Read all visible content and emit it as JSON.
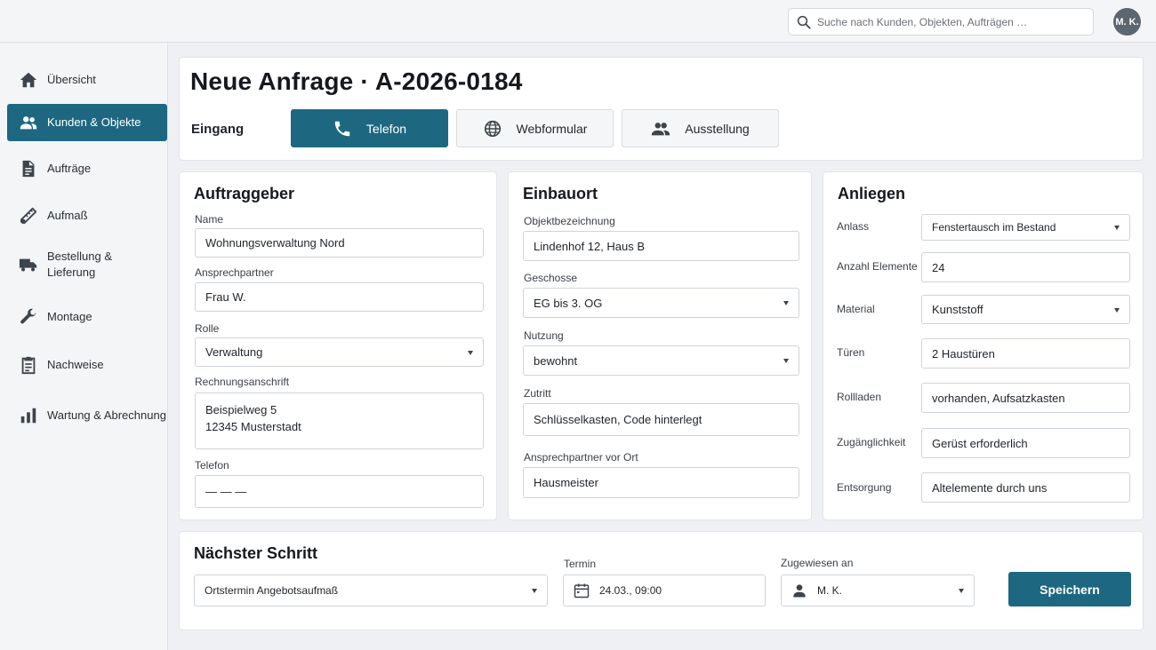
{
  "search": {
    "placeholder": "Suche nach Kunden, Objekten, Aufträgen …",
    "icon": "search-icon"
  },
  "user": {
    "initials": "M. K."
  },
  "sidebar": {
    "items": [
      {
        "label": "Übersicht",
        "icon": "home-icon",
        "active": false
      },
      {
        "label": "Kunden & Objekte",
        "icon": "people-icon",
        "active": true
      },
      {
        "label": "Aufträge",
        "icon": "document-icon",
        "active": false
      },
      {
        "label": "Aufmaß",
        "icon": "ruler-icon",
        "active": false
      },
      {
        "label": "Bestellung & Lieferung",
        "icon": "truck-icon",
        "active": false
      },
      {
        "label": "Montage",
        "icon": "wrench-icon",
        "active": false
      },
      {
        "label": "Nachweise",
        "icon": "clipboard-icon",
        "active": false
      },
      {
        "label": "Wartung & Abrechnung",
        "icon": "bar-chart-icon",
        "active": false
      }
    ]
  },
  "header": {
    "title": "Neue Anfrage · A-2026-0184",
    "channel_label": "Eingang",
    "channels": [
      {
        "label": "Telefon",
        "icon": "phone-icon",
        "active": true
      },
      {
        "label": "Webformular",
        "icon": "globe-icon",
        "active": false
      },
      {
        "label": "Ausstellung",
        "icon": "group-icon",
        "active": false
      }
    ]
  },
  "client": {
    "title": "Auftraggeber",
    "name_label": "Name",
    "name": "Wohnungsverwaltung Nord",
    "contact_label": "Ansprechpartner",
    "contact": "Frau W.",
    "role_label": "Rolle",
    "role": "Verwaltung",
    "billing_label": "Rechnungsanschrift",
    "billing_line1": "Beispielweg 5",
    "billing_line2": "12345 Musterstadt",
    "phone_label": "Telefon",
    "phone": "— — —"
  },
  "site": {
    "title": "Einbauort",
    "object_label": "Objektbezeichnung",
    "object": "Lindenhof 12, Haus B",
    "floors_label": "Geschosse",
    "floors": "EG bis 3. OG",
    "usage_label": "Nutzung",
    "usage": "bewohnt",
    "access_label": "Zutritt",
    "access": "Schlüsselkasten, Code hinterlegt",
    "onsite_contact_label": "Ansprechpartner vor Ort",
    "onsite_contact": "Hausmeister"
  },
  "request": {
    "title": "Anliegen",
    "occasion_label": "Anlass",
    "occasion": "Fenstertausch im Bestand",
    "count_label": "Anzahl Elemente",
    "count": "24",
    "material_label": "Material",
    "material": "Kunststoff",
    "doors_label": "Türen",
    "doors": "2 Haustüren",
    "shutters_label": "Rollladen",
    "shutters": "vorhanden, Aufsatzkasten",
    "accessibility_label": "Zugänglichkeit",
    "accessibility": "Gerüst erforderlich",
    "disposal_label": "Entsorgung",
    "disposal": "Altelemente durch uns"
  },
  "next_step": {
    "title": "Nächster Schritt",
    "step": "Ortstermin Angebotsaufmaß",
    "date_label": "Termin",
    "date": "24.03., 09:00",
    "assignee_label": "Zugewiesen an",
    "assignee": "M. K.",
    "save_label": "Speichern"
  },
  "colors": {
    "accent": "#1d6880",
    "background": "#eef0f3"
  }
}
